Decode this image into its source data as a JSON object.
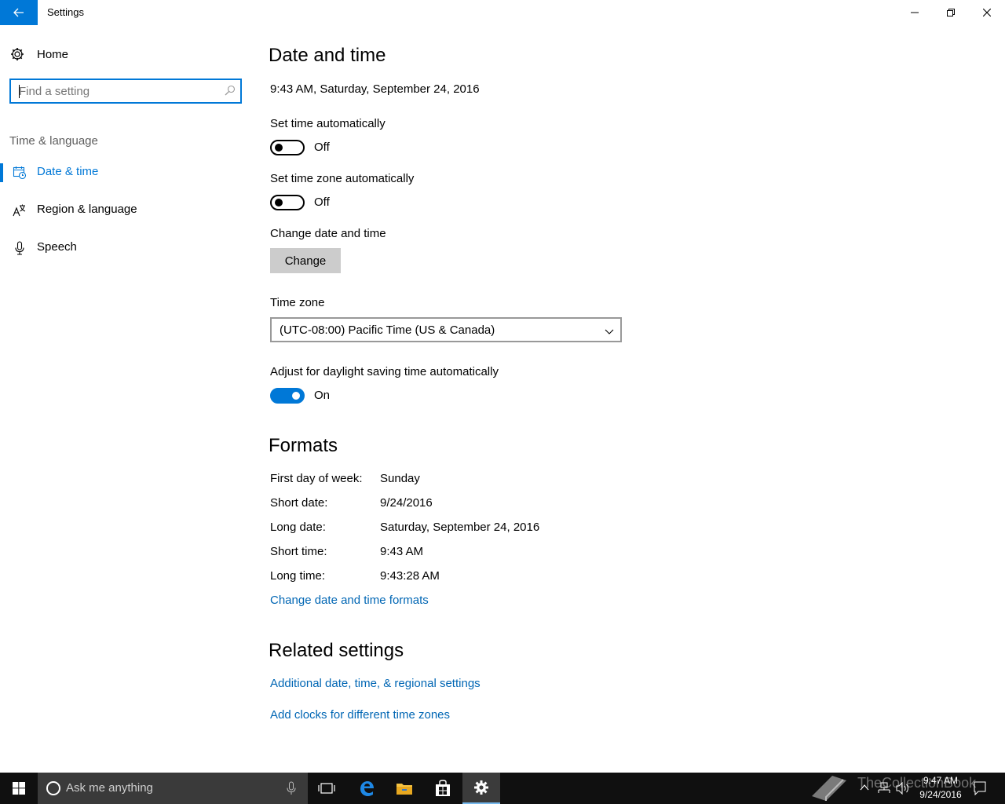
{
  "window": {
    "title": "Settings"
  },
  "sidebar": {
    "home_label": "Home",
    "search_placeholder": "Find a setting",
    "section_label": "Time & language",
    "items": [
      {
        "label": "Date & time",
        "active": true,
        "icon": "calendar-clock-icon"
      },
      {
        "label": "Region & language",
        "active": false,
        "icon": "language-icon"
      },
      {
        "label": "Speech",
        "active": false,
        "icon": "microphone-icon"
      }
    ]
  },
  "main": {
    "title": "Date and time",
    "current_datetime": "9:43 AM, Saturday, September 24, 2016",
    "set_time_auto": {
      "label": "Set time automatically",
      "state": "Off"
    },
    "set_timezone_auto": {
      "label": "Set time zone automatically",
      "state": "Off"
    },
    "change_datetime": {
      "label": "Change date and time",
      "button": "Change"
    },
    "time_zone": {
      "label": "Time zone",
      "value": "(UTC-08:00) Pacific Time (US & Canada)"
    },
    "daylight_saving": {
      "label": "Adjust for daylight saving time automatically",
      "state": "On"
    },
    "formats": {
      "title": "Formats",
      "rows": [
        {
          "label": "First day of week:",
          "value": "Sunday"
        },
        {
          "label": "Short date:",
          "value": "9/24/2016"
        },
        {
          "label": "Long date:",
          "value": "Saturday, September 24, 2016"
        },
        {
          "label": "Short time:",
          "value": "9:43 AM"
        },
        {
          "label": "Long time:",
          "value": "9:43:28 AM"
        }
      ],
      "change_link": "Change date and time formats"
    },
    "related": {
      "title": "Related settings",
      "links": [
        "Additional date, time, & regional settings",
        "Add clocks for different time zones"
      ]
    }
  },
  "taskbar": {
    "search_placeholder": "Ask me anything",
    "clock_time": "9:47 AM",
    "clock_date": "9/24/2016",
    "watermark": "TheCollectionBook"
  },
  "colors": {
    "accent": "#0078d7",
    "link": "#0066b4",
    "taskbar": "#101010"
  }
}
